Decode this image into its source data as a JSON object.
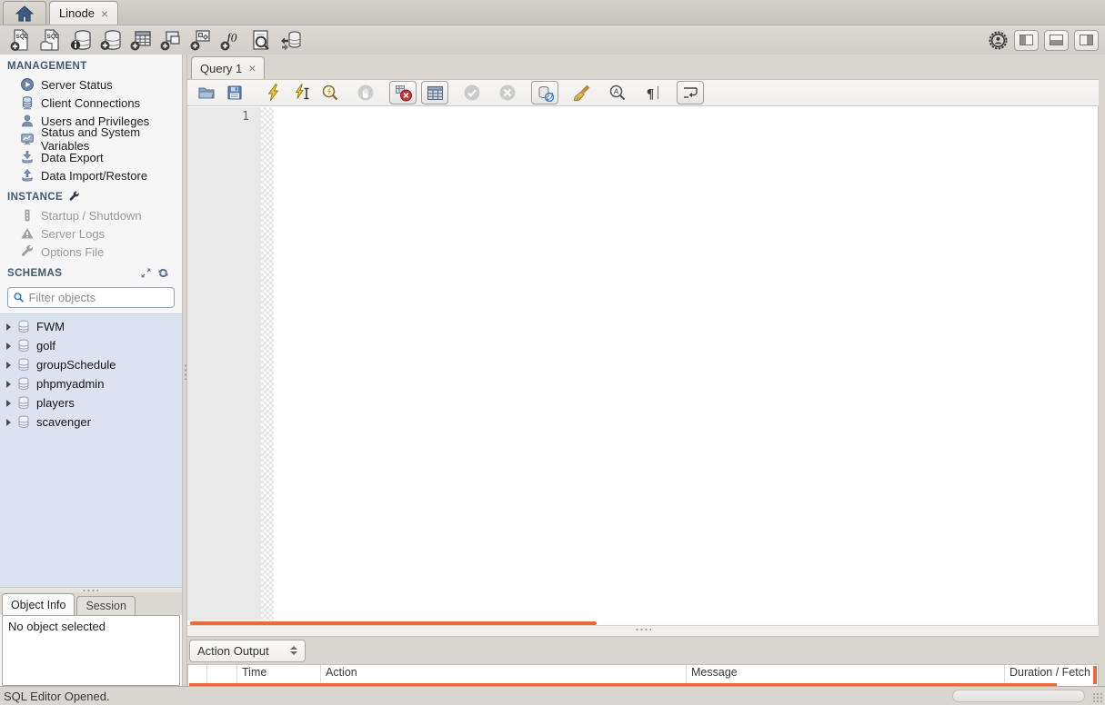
{
  "app": {
    "connection_tab": {
      "label": "Linode",
      "close": "×"
    },
    "status_text": "SQL Editor Opened."
  },
  "sidebar": {
    "management": {
      "title": "MANAGEMENT",
      "items": [
        {
          "label": "Server Status"
        },
        {
          "label": "Client Connections"
        },
        {
          "label": "Users and Privileges"
        },
        {
          "label": "Status and System Variables"
        },
        {
          "label": "Data Export"
        },
        {
          "label": "Data Import/Restore"
        }
      ]
    },
    "instance": {
      "title": "INSTANCE",
      "items": [
        {
          "label": "Startup / Shutdown",
          "disabled": true
        },
        {
          "label": "Server Logs",
          "disabled": true
        },
        {
          "label": "Options File",
          "disabled": true
        }
      ]
    },
    "schemas": {
      "title": "SCHEMAS",
      "filter_placeholder": "Filter objects",
      "items": [
        "FWM",
        "golf",
        "groupSchedule",
        "phpmyadmin",
        "players",
        "scavenger"
      ]
    },
    "bottom_tabs": [
      {
        "label": "Object Info",
        "active": true
      },
      {
        "label": "Session",
        "active": false
      }
    ],
    "object_info_text": "No object selected"
  },
  "editor": {
    "tab": {
      "label": "Query 1",
      "close": "×"
    },
    "line_numbers": [
      "1"
    ]
  },
  "action_output": {
    "selector": "Action Output",
    "columns": [
      "",
      "",
      "Time",
      "Action",
      "Message",
      "Duration / Fetch"
    ]
  },
  "icons": {
    "close": "×",
    "main_toolbar": [
      "new-sql-tab",
      "open-sql-script",
      "schema-inspector",
      "create-schema",
      "create-table",
      "create-view",
      "create-procedure",
      "create-function",
      "search-data",
      "reconnect-dbms"
    ],
    "toolbar_right": [
      "connection-user",
      "toggle-left-panel",
      "toggle-bottom-panel",
      "toggle-right-panel"
    ],
    "sql_toolbar": [
      "open-script",
      "save-script",
      "execute",
      "execute-current",
      "explain",
      "stop",
      "toggle-stop-on-error",
      "limit-rows",
      "commit",
      "rollback",
      "toggle-autocommit",
      "beautify",
      "find",
      "show-invisibles",
      "wrap-text"
    ]
  },
  "colors": {
    "accent_orange": "#e8693c",
    "section_header": "#44576d",
    "schema_list_bg": "#dbe3f1"
  }
}
